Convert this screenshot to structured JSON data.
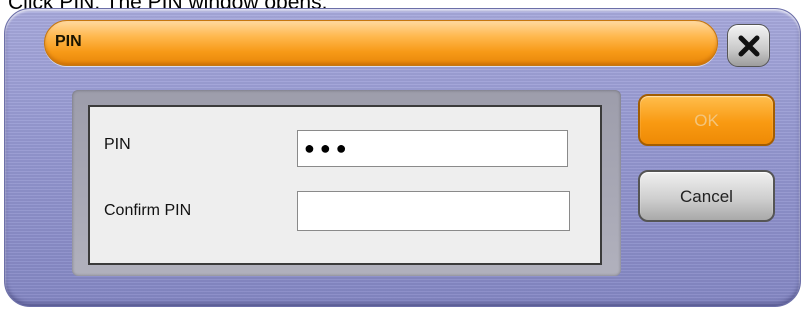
{
  "caption": "Click PIN. The PIN window opens.",
  "dialog": {
    "title": "PIN",
    "close_icon": "close-icon"
  },
  "form": {
    "pin_label": "PIN",
    "pin_value": "●●●",
    "confirm_label": "Confirm PIN",
    "confirm_value": ""
  },
  "buttons": {
    "ok_label": "OK",
    "cancel_label": "Cancel"
  },
  "colors": {
    "title_bar": "#f79a17",
    "dialog_frame": "#9598d1",
    "ok_button": "#f99a12"
  }
}
